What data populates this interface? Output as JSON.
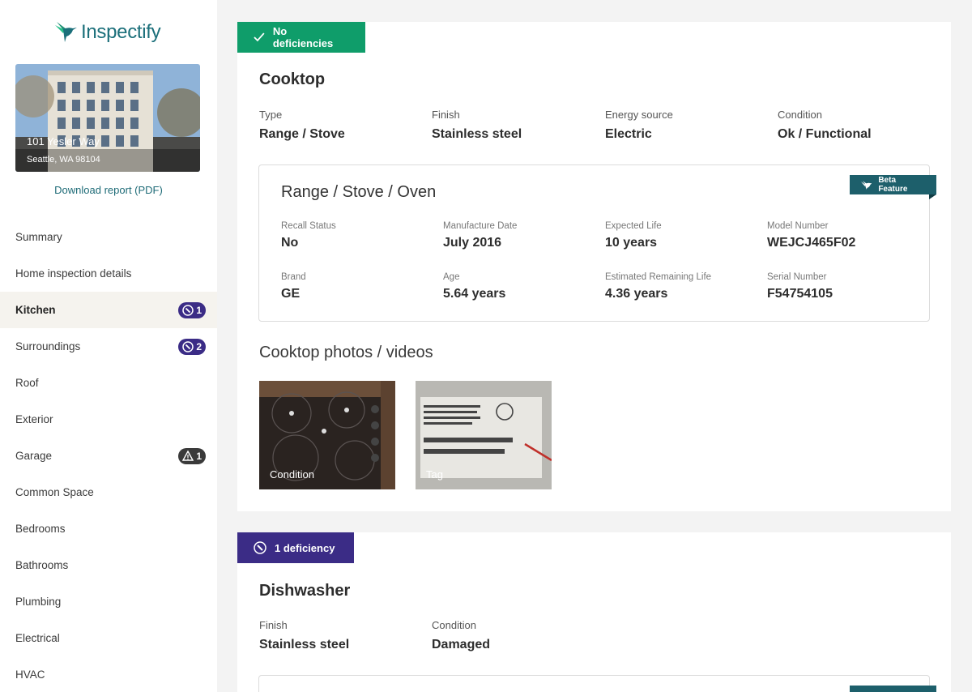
{
  "brand": {
    "name": "Inspectify"
  },
  "property": {
    "address_line1": "101 Yesler Way",
    "address_line2": "Seattle, WA 98104"
  },
  "download_label": "Download report (PDF)",
  "nav": [
    {
      "label": "Summary"
    },
    {
      "label": "Home inspection details"
    },
    {
      "label": "Kitchen",
      "badge": "1",
      "badge_icon": "wrench-icon"
    },
    {
      "label": "Surroundings",
      "badge": "2",
      "badge_icon": "wrench-icon"
    },
    {
      "label": "Roof"
    },
    {
      "label": "Exterior"
    },
    {
      "label": "Garage",
      "badge": "1",
      "badge_icon": "warning-icon"
    },
    {
      "label": "Common Space"
    },
    {
      "label": "Bedrooms"
    },
    {
      "label": "Bathrooms"
    },
    {
      "label": "Plumbing"
    },
    {
      "label": "Electrical"
    },
    {
      "label": "HVAC"
    }
  ],
  "cooktop": {
    "status": "No deficiencies",
    "status_color": "#0f9d6a",
    "title": "Cooktop",
    "fields": [
      {
        "label": "Type",
        "value": "Range / Stove"
      },
      {
        "label": "Finish",
        "value": "Stainless steel"
      },
      {
        "label": "Energy source",
        "value": "Electric"
      },
      {
        "label": "Condition",
        "value": "Ok / Functional"
      }
    ],
    "appliance": {
      "title": "Range / Stove / Oven",
      "beta_label": "Beta Feature",
      "fields": [
        {
          "label": "Recall Status",
          "value": "No"
        },
        {
          "label": "Manufacture Date",
          "value": "July 2016"
        },
        {
          "label": "Expected Life",
          "value": "10 years"
        },
        {
          "label": "Model Number",
          "value": "WEJCJ465F02"
        },
        {
          "label": "Brand",
          "value": "GE"
        },
        {
          "label": "Age",
          "value": "5.64 years"
        },
        {
          "label": "Estimated Remaining Life",
          "value": "4.36 years"
        },
        {
          "label": "Serial Number",
          "value": "F54754105"
        }
      ]
    },
    "photos_title": "Cooktop photos / videos",
    "photos": [
      {
        "caption": "Condition"
      },
      {
        "caption": "Tag"
      }
    ]
  },
  "dishwasher": {
    "status": "1 deficiency",
    "status_color": "#3b2c86",
    "title": "Dishwasher",
    "fields": [
      {
        "label": "Finish",
        "value": "Stainless steel"
      },
      {
        "label": "Condition",
        "value": "Damaged"
      }
    ]
  }
}
